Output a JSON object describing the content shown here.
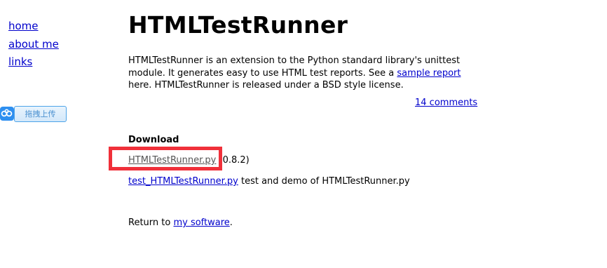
{
  "nav": {
    "items": [
      {
        "label": "home"
      },
      {
        "label": "about me"
      },
      {
        "label": "links"
      }
    ]
  },
  "upload_widget": {
    "label": "拖拽上传",
    "icon": "baidu-cloud-icon",
    "accent": "#2e8ff0"
  },
  "main": {
    "title": "HTMLTestRunner",
    "intro": {
      "text_before": "HTMLTestRunner is an extension to the Python standard library's unittest module. It generates easy to use HTML test reports. See a ",
      "link_label": "sample report",
      "text_after": " here. HTMLTestRunner is released under a BSD style license."
    },
    "comments_link": "14 comments",
    "download": {
      "heading": "Download",
      "files": [
        {
          "link": "HTMLTestRunner.py",
          "description": " (0.8.2)"
        },
        {
          "link": "test_HTMLTestRunner.py",
          "description": " test and demo of HTMLTestRunner.py"
        }
      ]
    },
    "return_line": {
      "prefix": "Return to ",
      "link": "my software",
      "suffix": "."
    }
  },
  "annotation": {
    "highlight_color": "#f0303a"
  }
}
